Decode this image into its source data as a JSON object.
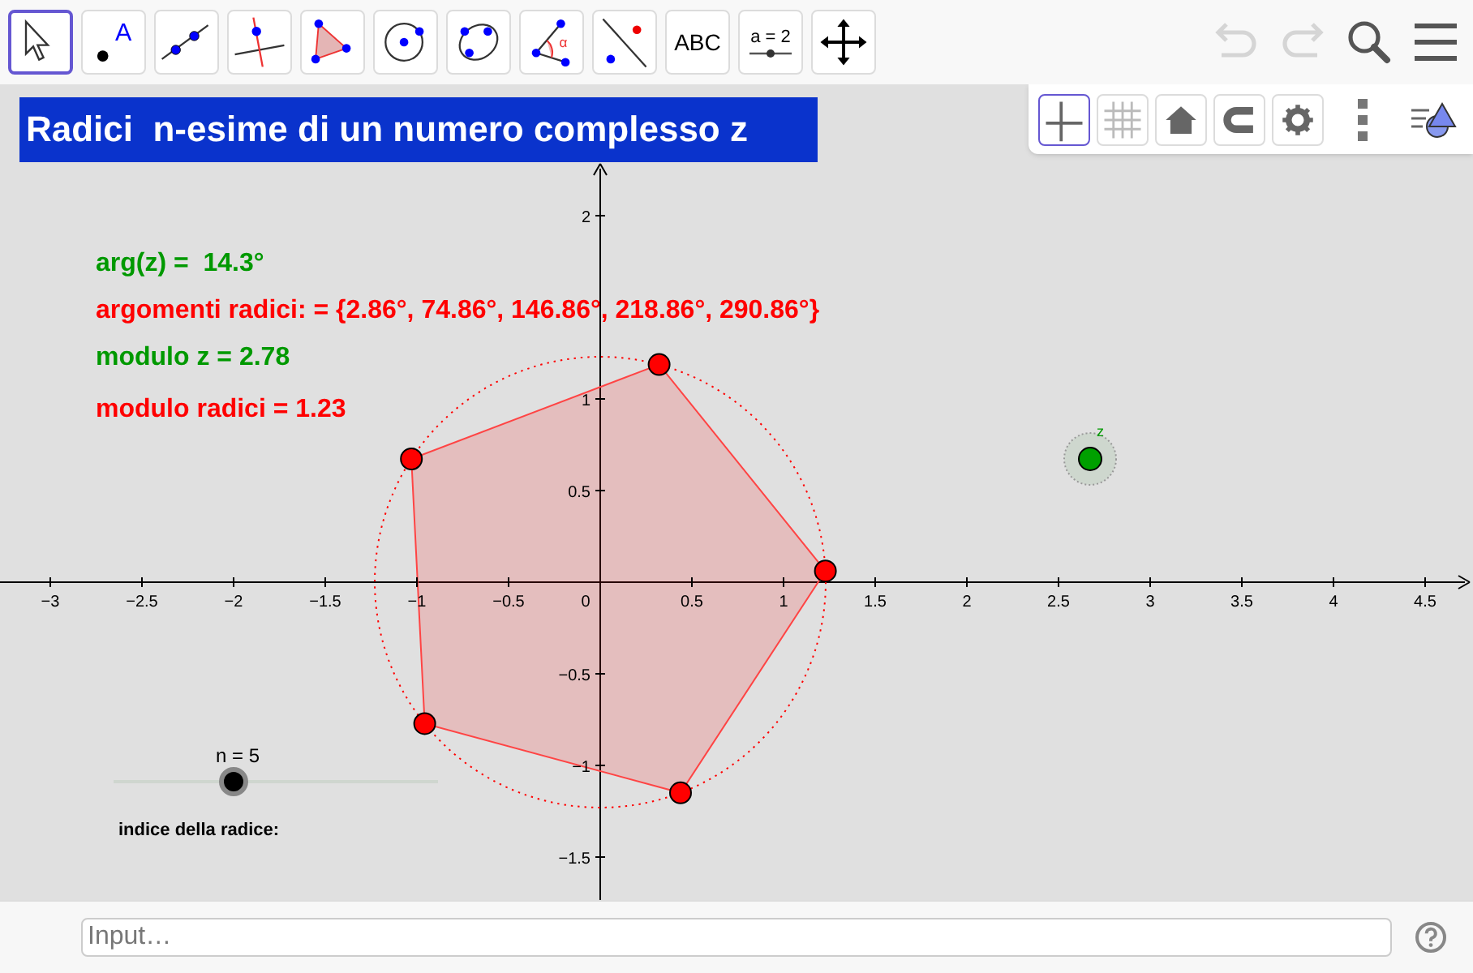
{
  "toolbar": {
    "tools": [
      {
        "kind": "move",
        "selected": true
      },
      {
        "kind": "point",
        "label": "A",
        "selected": false
      },
      {
        "kind": "line",
        "selected": false
      },
      {
        "kind": "perpendicular",
        "selected": false
      },
      {
        "kind": "polygon",
        "selected": false
      },
      {
        "kind": "circle",
        "selected": false
      },
      {
        "kind": "conic",
        "selected": false
      },
      {
        "kind": "angle",
        "label": "α",
        "selected": false
      },
      {
        "kind": "reflect",
        "selected": false
      },
      {
        "kind": "text",
        "label": "ABC",
        "selected": false
      },
      {
        "kind": "slider",
        "label": "a = 2",
        "selected": false
      },
      {
        "kind": "pan",
        "selected": false
      }
    ],
    "undo": {
      "disabled": true
    },
    "redo": {
      "disabled": true
    }
  },
  "style_bar": {
    "buttons": [
      {
        "kind": "axes",
        "selected": true
      },
      {
        "kind": "grid",
        "selected": false
      },
      {
        "kind": "home",
        "selected": false
      },
      {
        "kind": "magnet",
        "selected": false
      },
      {
        "kind": "settings",
        "selected": false
      }
    ]
  },
  "title": "Radici  n-esime di un numero complesso z",
  "texts": [
    {
      "text": "arg(z) =  14.3°",
      "color": "#009900"
    },
    {
      "text": "argomenti radici: = {2.86°, 74.86°, 146.86°, 218.86°, 290.86°}",
      "color": "#ff0000"
    },
    {
      "text": "modulo z = 2.78",
      "color": "#009900"
    },
    {
      "text": "modulo radici = 1.23",
      "color": "#ff0000"
    }
  ],
  "x_axis_labels": [
    "−3",
    "−2.5",
    "−2",
    "−1.5",
    "−1",
    "−0.5",
    "0",
    "0.5",
    "1",
    "1.5",
    "2",
    "2.5",
    "3",
    "3.5",
    "4",
    "4.5"
  ],
  "y_axis_labels": [
    "2",
    "1",
    "0.5",
    "−0.5",
    "−1",
    "−1.5"
  ],
  "point_label": "z",
  "slider": {
    "label": "n = 5",
    "level": 0.37,
    "caption": "indice della radice:"
  },
  "input_bar": {
    "placeholder": "Input…"
  }
}
